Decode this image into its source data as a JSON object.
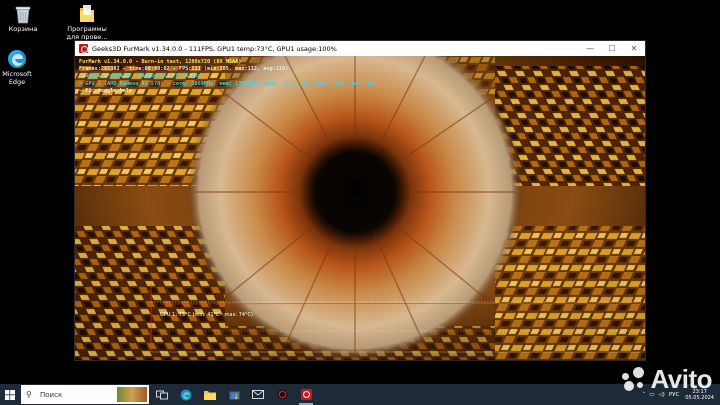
{
  "desktop": {
    "icons": [
      {
        "label": "Корзина",
        "icon": "recycle-bin-icon"
      },
      {
        "label": "Программы для прове...",
        "icon": "folder-icon"
      },
      {
        "label": "Microsoft Edge",
        "icon": "edge-icon"
      }
    ]
  },
  "window": {
    "title": "Geeks3D FurMark v1.34.0.0 - 111FPS, GPU1 temp:73°C, GPU1 usage:100%",
    "controls": {
      "minimize": "—",
      "maximize": "☐",
      "close": "✕"
    }
  },
  "overlay": {
    "line1": "FurMark v1.34.0.0 - Burn-in test, 1280x720 (8X MSAA)",
    "line2": "Frames:265382 - time:00:40:02 - FPS:111 (min:105, max:112, avg:110)",
    "line3": "> OpenGL renderer: Radeon RX 570 Series",
    "line4": "> GPU 1 (AMD Radeon RX 570) - core: 1069MHz, mem: 1750MHz, temp: 73°C, GPU load: 100%, fan: 98%",
    "line5": "- F1: toggle help"
  },
  "graph": {
    "label": "GPU 1: 73°C (min: 41°C - max: 74°C)",
    "current": 73,
    "min": 41,
    "max": 74
  },
  "taskbar": {
    "search_placeholder": "Поиск",
    "apps": [
      "task-view-icon",
      "edge-icon",
      "file-explorer-icon",
      "store-icon",
      "mail-icon",
      "furmark-icon",
      "furmark-window-icon"
    ],
    "language": "РУС",
    "time": "23:17",
    "date": "05.05.2024"
  },
  "watermark": {
    "text": "Avito"
  },
  "colors": {
    "taskbar": "#1e2a38",
    "overlay_yellow": "#f3e86a",
    "overlay_cyan": "#3fd6e8",
    "furmark_red": "#c8161d"
  }
}
